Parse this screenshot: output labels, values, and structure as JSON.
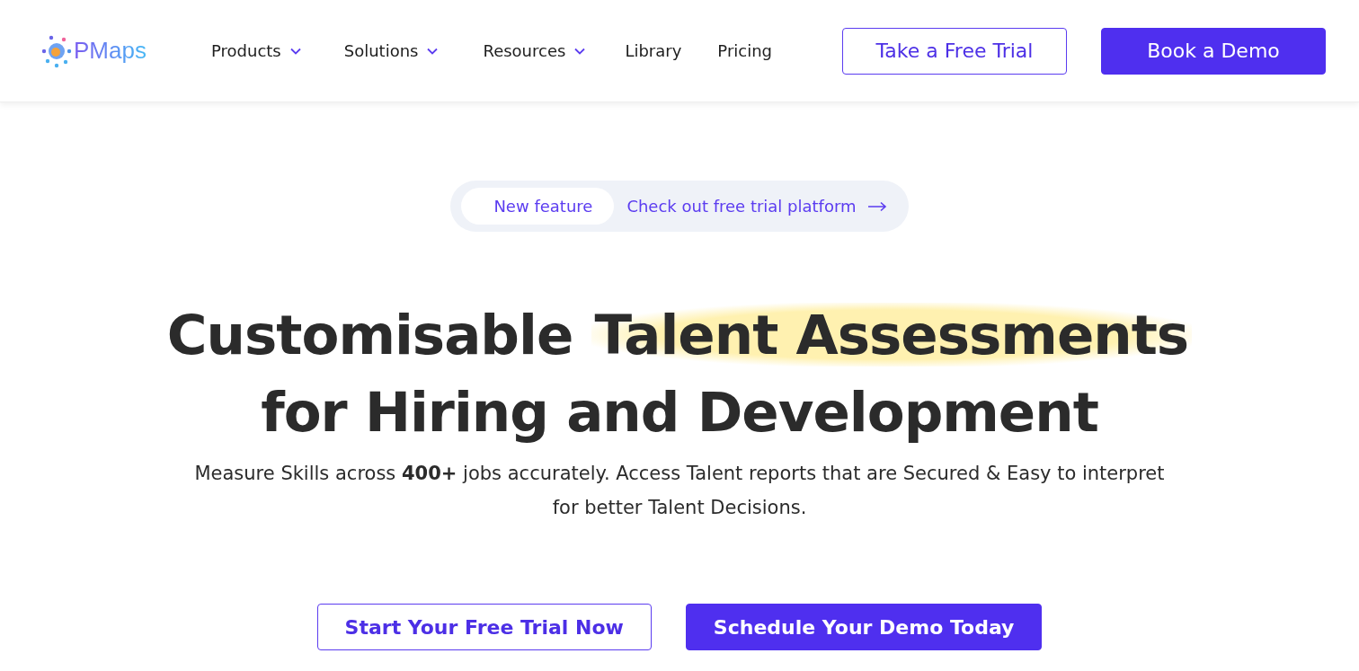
{
  "logo": {
    "text": "PMaps"
  },
  "nav": [
    {
      "label": "Products",
      "has_menu": true
    },
    {
      "label": "Solutions",
      "has_menu": true
    },
    {
      "label": "Resources",
      "has_menu": true
    },
    {
      "label": "Library",
      "has_menu": false
    },
    {
      "label": "Pricing",
      "has_menu": false
    }
  ],
  "header_buttons": [
    {
      "label": "Take a Free Trial",
      "kind": "outline"
    },
    {
      "label": "Book a Demo",
      "kind": "solid"
    }
  ],
  "announcement": {
    "badge": "New feature",
    "link": "Check out free trial platform"
  },
  "hero": {
    "title_lines": [
      [
        {
          "text": "Customisable ",
          "highlighted": false
        },
        {
          "text": "Talent Assessments",
          "highlighted": true
        }
      ],
      [
        {
          "text": "for Hiring and Development",
          "highlighted": false
        }
      ]
    ],
    "subtitle": "Measure Skills across **400+** jobs accurately. Access Talent reports that are Secured & Easy to interpret for better Talent Decisions."
  },
  "cta_buttons": [
    {
      "label": "Start Your Free Trial Now",
      "kind": "outline"
    },
    {
      "label": "Schedule Your Demo Today",
      "kind": "solid"
    }
  ]
}
